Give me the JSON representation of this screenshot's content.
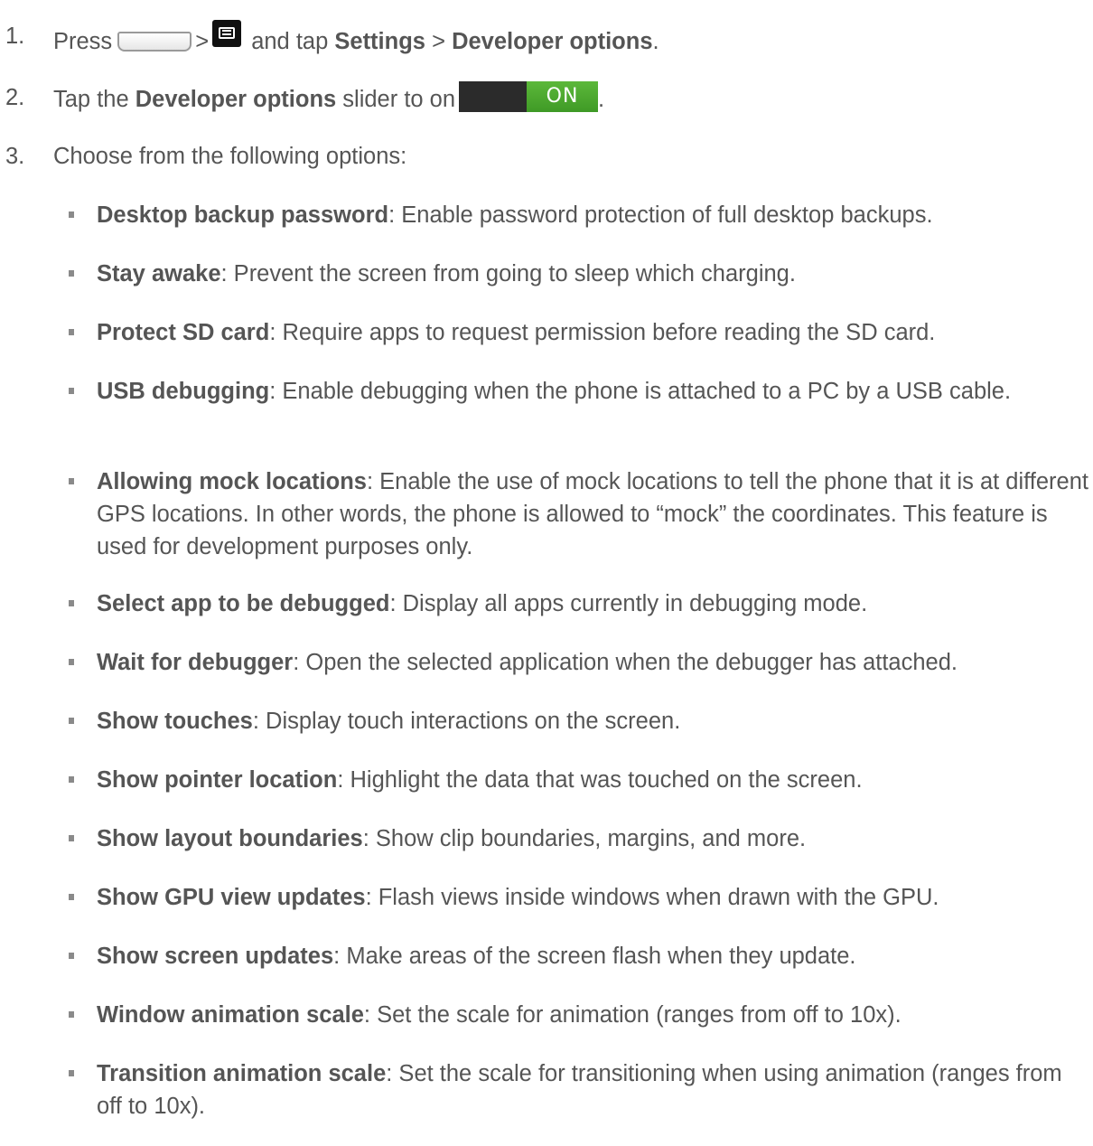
{
  "steps": [
    {
      "number": "1.",
      "press": "Press",
      "icon_home": "home-key-icon",
      "sep1": ">",
      "icon_menu": "menu-key-icon",
      "and_tap": "and tap",
      "settings": "Settings",
      "sep2": ">",
      "developer_options": "Developer options",
      "period": "."
    },
    {
      "number": "2.",
      "tap_the": "Tap the",
      "developer_options": "Developer options",
      "slider_text": "slider to on",
      "toggle_label": "ON",
      "period": "."
    },
    {
      "number": "3.",
      "text": "Choose from the following options:"
    }
  ],
  "options": [
    {
      "term": "Desktop backup password",
      "desc": ": Enable password protection of full desktop backups."
    },
    {
      "term": "Stay awake",
      "desc": ": Prevent the screen from going to sleep which charging."
    },
    {
      "term": "Protect SD card",
      "desc": ": Require apps to request permission before reading the SD card."
    },
    {
      "term": "USB debugging",
      "desc": ": Enable debugging when the phone is attached to a PC by a USB cable."
    },
    {
      "term": "Allowing mock locations",
      "desc": ": Enable the use of mock locations to tell the phone that it is at different GPS locations. In other words, the phone is allowed to “mock” the coordinates. This feature is used for development purposes only."
    },
    {
      "term": "Select app to be debugged",
      "desc": ": Display all apps currently in debugging mode."
    },
    {
      "term": "Wait for debugger",
      "desc": ": Open the selected application when the debugger has attached."
    },
    {
      "term": "Show touches",
      "desc": ": Display touch interactions on the screen."
    },
    {
      "term": "Show pointer location",
      "desc": ": Highlight the data that was touched on the screen."
    },
    {
      "term": "Show layout boundaries",
      "desc": ": Show clip boundaries, margins, and more."
    },
    {
      "term": "Show GPU view updates",
      "desc": ": Flash views inside windows when drawn with the GPU."
    },
    {
      "term": "Show screen updates",
      "desc": ": Make areas of the screen flash when they update."
    },
    {
      "term": "Window animation scale",
      "desc": ": Set the scale for animation (ranges from off to 10x)."
    },
    {
      "term": "Transition animation scale",
      "desc": ": Set the scale for transitioning when using animation (ranges from off to 10x)."
    }
  ],
  "colors": {
    "text": "#555555",
    "toggle_on": "#4caf2f",
    "toggle_track": "#2b2b2b"
  }
}
